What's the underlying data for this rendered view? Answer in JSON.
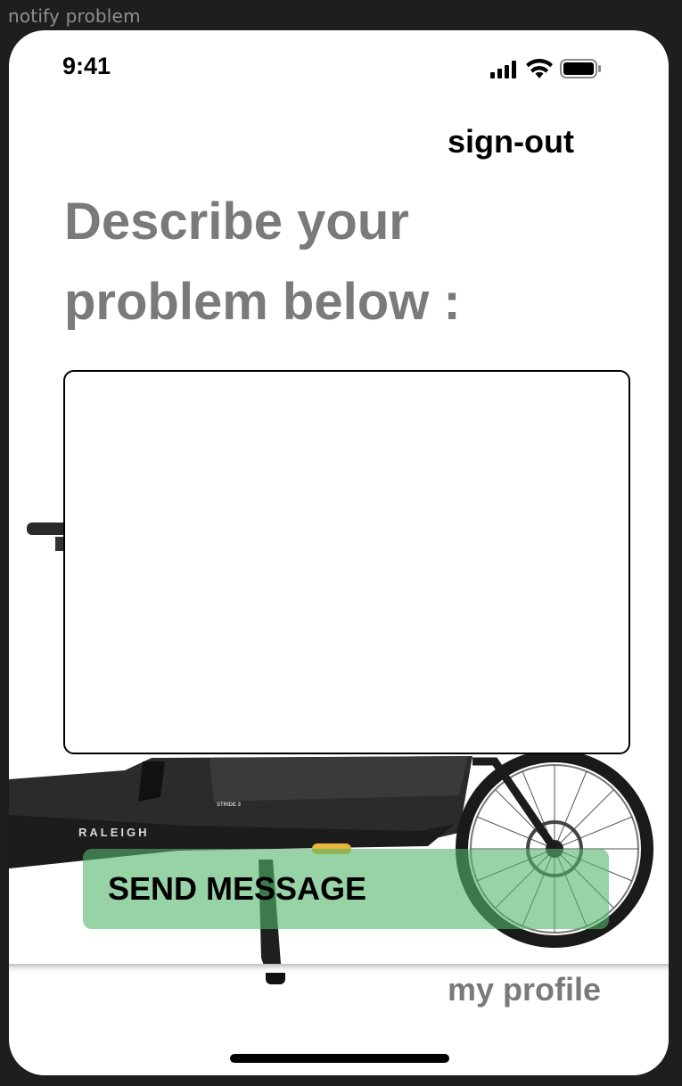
{
  "frame": {
    "title": "notify problem"
  },
  "status_bar": {
    "time": "9:41",
    "icons": [
      "cellular-signal-icon",
      "wifi-icon",
      "battery-icon"
    ]
  },
  "header": {
    "signout_label": "sign-out"
  },
  "main": {
    "heading": "Describe your problem below :",
    "problem_input": {
      "value": "",
      "placeholder": ""
    },
    "background_image": {
      "brand_text": "RALEIGH",
      "model_text": "STRIDE 3"
    }
  },
  "actions": {
    "send_label": "SEND MESSAGE"
  },
  "tab_bar": {
    "profile_label": "my profile"
  },
  "colors": {
    "heading": "#7a7a7a",
    "send_button": "#54b66c",
    "background": "#1e1e1e"
  }
}
